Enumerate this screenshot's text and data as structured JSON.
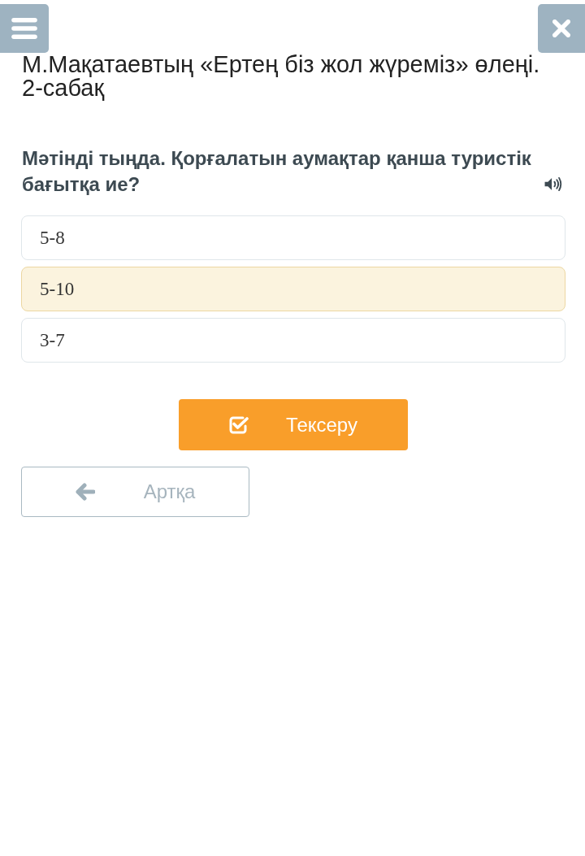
{
  "lesson_title": "М.Мақатаевтың «Ертең біз жол жүреміз» өлеңі. 2-сабақ",
  "question": {
    "text": "Мәтінді тыңда. Қорғалатын аумақтар қанша туристік бағытқа ие?"
  },
  "options": [
    {
      "label": "5-8",
      "selected": false
    },
    {
      "label": "5-10",
      "selected": true
    },
    {
      "label": "3-7",
      "selected": false
    }
  ],
  "buttons": [
    {
      "kind": "check",
      "label": "Тексеру"
    },
    {
      "kind": "back",
      "label": "Артқа"
    }
  ]
}
